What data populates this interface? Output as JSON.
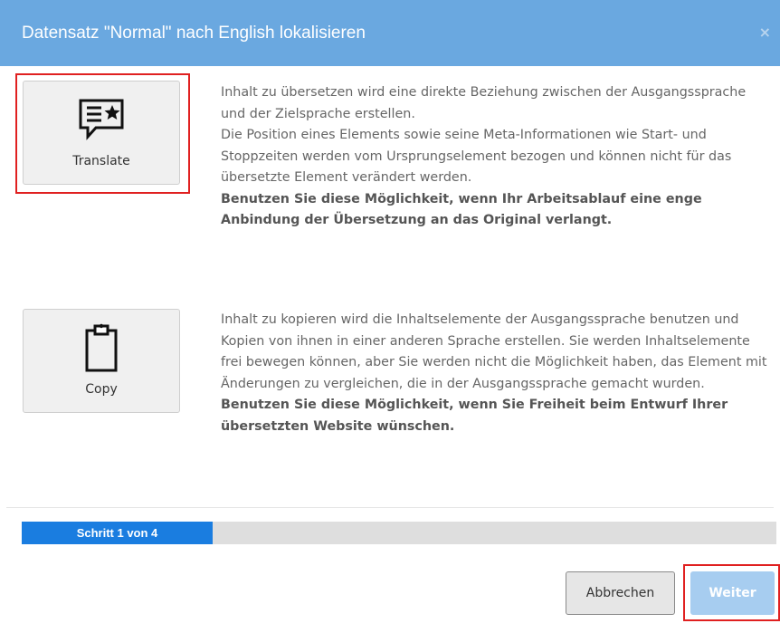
{
  "dialog": {
    "title": "Datensatz \"Normal\" nach English lokalisieren",
    "close_symbol": "×"
  },
  "options": [
    {
      "label": "Translate",
      "icon": "speech-bubble-star-icon",
      "selected": true,
      "paragraph1": "Inhalt zu übersetzen wird eine direkte Beziehung zwischen der Ausgangssprache und der Zielsprache erstellen.",
      "paragraph2": "Die Position eines Elements sowie seine Meta-Informationen wie Start- und Stoppzeiten werden vom Ursprungselement bezogen und können nicht für das übersetzte Element verändert werden.",
      "emphasis": "Benutzen Sie diese Möglichkeit, wenn Ihr Arbeitsablauf eine enge Anbindung der Übersetzung an das Original verlangt."
    },
    {
      "label": "Copy",
      "icon": "clipboard-icon",
      "selected": false,
      "paragraph1": "Inhalt zu kopieren wird die Inhaltselemente der Ausgangssprache benutzen und Kopien von ihnen in einer anderen Sprache erstellen. Sie werden Inhaltselemente frei bewegen können, aber Sie werden nicht die Möglichkeit haben, das Element mit Änderungen zu vergleichen, die in der Ausgangssprache gemacht wurden.",
      "emphasis": "Benutzen Sie diese Möglichkeit, wenn Sie Freiheit beim Entwurf Ihrer übersetzten Website wünschen."
    }
  ],
  "progress": {
    "label": "Schritt 1 von 4",
    "current_step": 1,
    "total_steps": 4,
    "fraction": 0.25
  },
  "footer": {
    "cancel_label": "Abbrechen",
    "next_label": "Weiter",
    "next_highlighted": true
  },
  "colors": {
    "header": "#6aa8e0",
    "progress_fill": "#1a7de0",
    "highlight": "#e02020",
    "next_button": "#a7cdf0"
  }
}
